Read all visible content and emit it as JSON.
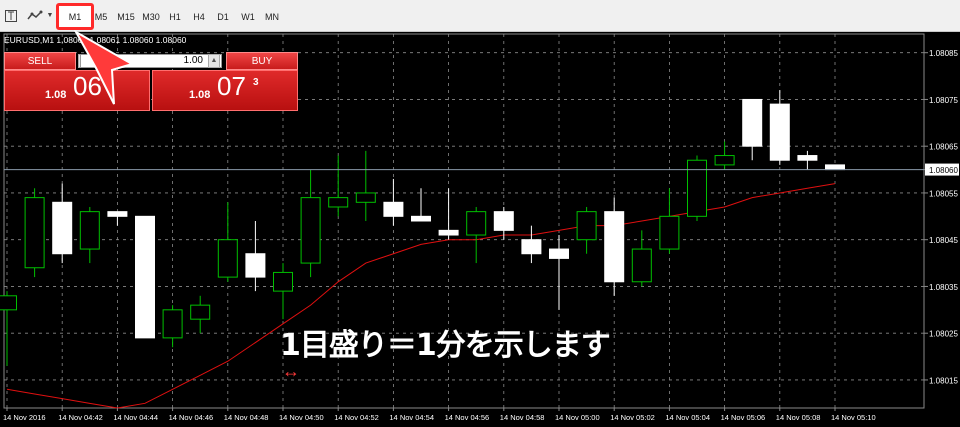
{
  "toolbar": {
    "icons": [
      "crosshair-icon",
      "indicators-icon",
      "dropdown-icon"
    ],
    "timeframes": [
      "M1",
      "M5",
      "M15",
      "M30",
      "H1",
      "H4",
      "D1",
      "W1",
      "MN"
    ],
    "active_timeframe": "M1"
  },
  "chart_header": {
    "symbol_line": "EURUSD,M1  1.08061 1.08061 1.08060 1.08060"
  },
  "trade_panel": {
    "sell_label": "SELL",
    "buy_label": "BUY",
    "volume": "1.00",
    "sell_small": "1.08",
    "sell_big": "06",
    "sell_sup": "5",
    "buy_small": "1.08",
    "buy_big": "07",
    "buy_sup": "3"
  },
  "annotation": {
    "text": "1目盛り＝1分を示します"
  },
  "colors": {
    "background": "#000000",
    "grid": "#8a8a8a",
    "bull_candle": "#00c000",
    "bear_candle": "#ffffff",
    "ma_line": "#e01010",
    "price_line": "#8a9aaa",
    "accent_red": "#ff2a2a"
  },
  "chart_data": {
    "type": "candlestick",
    "symbol": "EURUSD",
    "timeframe": "M1",
    "ylim": [
      1.08009,
      1.08089
    ],
    "y_ticks": [
      "1.08085",
      "1.08075",
      "1.08065",
      "1.08060",
      "1.08055",
      "1.08045",
      "1.08035",
      "1.08025",
      "1.08015"
    ],
    "current_price": 1.0806,
    "x_ticks": [
      "14 Nov 2016",
      "14 Nov 04:42",
      "14 Nov 04:44",
      "14 Nov 04:46",
      "14 Nov 04:48",
      "14 Nov 04:50",
      "14 Nov 04:52",
      "14 Nov 04:54",
      "14 Nov 04:56",
      "14 Nov 04:58",
      "14 Nov 05:00",
      "14 Nov 05:02",
      "14 Nov 05:04",
      "14 Nov 05:06",
      "14 Nov 05:08",
      "14 Nov 05:10"
    ],
    "candles": [
      {
        "o": 1.0803,
        "h": 1.08034,
        "l": 1.08018,
        "c": 1.08033
      },
      {
        "o": 1.08039,
        "h": 1.08056,
        "l": 1.08037,
        "c": 1.08054
      },
      {
        "o": 1.08053,
        "h": 1.08057,
        "l": 1.0804,
        "c": 1.08042
      },
      {
        "o": 1.08043,
        "h": 1.08052,
        "l": 1.0804,
        "c": 1.08051
      },
      {
        "o": 1.08051,
        "h": 1.08051,
        "l": 1.08048,
        "c": 1.0805
      },
      {
        "o": 1.0805,
        "h": 1.0805,
        "l": 1.08024,
        "c": 1.08024
      },
      {
        "o": 1.08024,
        "h": 1.08031,
        "l": 1.08022,
        "c": 1.0803
      },
      {
        "o": 1.08028,
        "h": 1.08033,
        "l": 1.08025,
        "c": 1.08031
      },
      {
        "o": 1.08037,
        "h": 1.08053,
        "l": 1.08036,
        "c": 1.08045
      },
      {
        "o": 1.08042,
        "h": 1.08049,
        "l": 1.08034,
        "c": 1.08037
      },
      {
        "o": 1.08034,
        "h": 1.0804,
        "l": 1.08028,
        "c": 1.08038
      },
      {
        "o": 1.0804,
        "h": 1.0806,
        "l": 1.08037,
        "c": 1.08054
      },
      {
        "o": 1.08052,
        "h": 1.08063,
        "l": 1.0805,
        "c": 1.08054
      },
      {
        "o": 1.08053,
        "h": 1.08064,
        "l": 1.08049,
        "c": 1.08055
      },
      {
        "o": 1.08053,
        "h": 1.08058,
        "l": 1.08048,
        "c": 1.0805
      },
      {
        "o": 1.0805,
        "h": 1.08056,
        "l": 1.08049,
        "c": 1.08049
      },
      {
        "o": 1.08047,
        "h": 1.08056,
        "l": 1.08045,
        "c": 1.08046
      },
      {
        "o": 1.08046,
        "h": 1.08052,
        "l": 1.0804,
        "c": 1.08051
      },
      {
        "o": 1.08051,
        "h": 1.08052,
        "l": 1.08045,
        "c": 1.08047
      },
      {
        "o": 1.08045,
        "h": 1.08048,
        "l": 1.0804,
        "c": 1.08042
      },
      {
        "o": 1.08043,
        "h": 1.08046,
        "l": 1.0803,
        "c": 1.08041
      },
      {
        "o": 1.08045,
        "h": 1.08052,
        "l": 1.08042,
        "c": 1.08051
      },
      {
        "o": 1.08051,
        "h": 1.08054,
        "l": 1.08033,
        "c": 1.08036
      },
      {
        "o": 1.08036,
        "h": 1.08047,
        "l": 1.08035,
        "c": 1.08043
      },
      {
        "o": 1.08043,
        "h": 1.08056,
        "l": 1.08042,
        "c": 1.0805
      },
      {
        "o": 1.0805,
        "h": 1.08063,
        "l": 1.08049,
        "c": 1.08062
      },
      {
        "o": 1.08061,
        "h": 1.08066,
        "l": 1.0806,
        "c": 1.08063
      },
      {
        "o": 1.08075,
        "h": 1.08075,
        "l": 1.08062,
        "c": 1.08065
      },
      {
        "o": 1.08074,
        "h": 1.08077,
        "l": 1.08061,
        "c": 1.08062
      },
      {
        "o": 1.08063,
        "h": 1.08064,
        "l": 1.0806,
        "c": 1.08062
      },
      {
        "o": 1.08061,
        "h": 1.08061,
        "l": 1.0806,
        "c": 1.0806
      }
    ],
    "ma_line": [
      1.08013,
      1.08012,
      1.08011,
      1.0801,
      1.08009,
      1.0801,
      1.08013,
      1.08016,
      1.08019,
      1.08023,
      1.08027,
      1.08031,
      1.08036,
      1.0804,
      1.08042,
      1.08044,
      1.08045,
      1.08045,
      1.08046,
      1.08046,
      1.08047,
      1.08048,
      1.08048,
      1.08049,
      1.0805,
      1.08051,
      1.08052,
      1.08054,
      1.08055,
      1.08056,
      1.08057
    ]
  }
}
